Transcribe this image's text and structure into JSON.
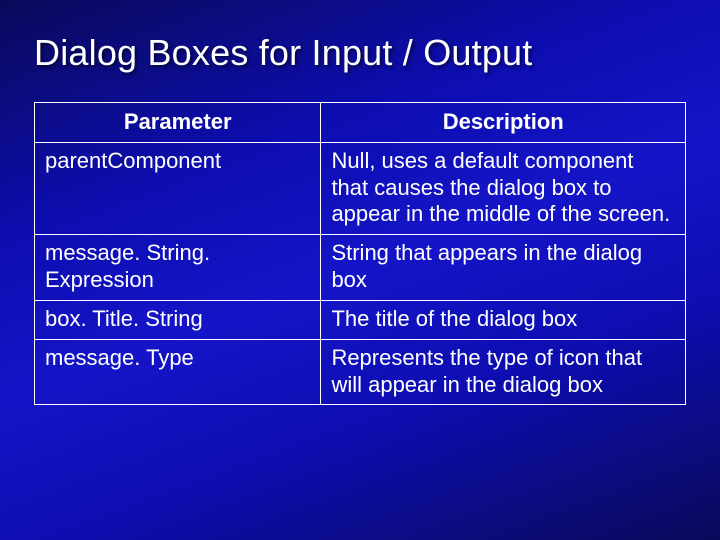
{
  "slide": {
    "title": "Dialog Boxes for Input / Output",
    "headers": {
      "parameter": "Parameter",
      "description": "Description"
    },
    "rows": [
      {
        "parameter": "parentComponent",
        "description": "Null, uses a default component that causes the dialog box to appear in the middle of the screen."
      },
      {
        "parameter": "message. String. Expression",
        "description": "String that appears in the dialog box"
      },
      {
        "parameter": "box. Title. String",
        "description": "The title of the dialog box"
      },
      {
        "parameter": "message. Type",
        "description": "Represents the type of icon that will appear in the dialog box"
      }
    ]
  },
  "chart_data": {
    "type": "table",
    "title": "Dialog Boxes for Input / Output",
    "columns": [
      "Parameter",
      "Description"
    ],
    "rows": [
      [
        "parentComponent",
        "Null, uses a default component that causes the dialog box to appear in the middle of the screen."
      ],
      [
        "message. String. Expression",
        "String that appears in the dialog box"
      ],
      [
        "box. Title. String",
        "The title of the dialog box"
      ],
      [
        "message. Type",
        "Represents the type of icon that will appear in the dialog box"
      ]
    ]
  }
}
